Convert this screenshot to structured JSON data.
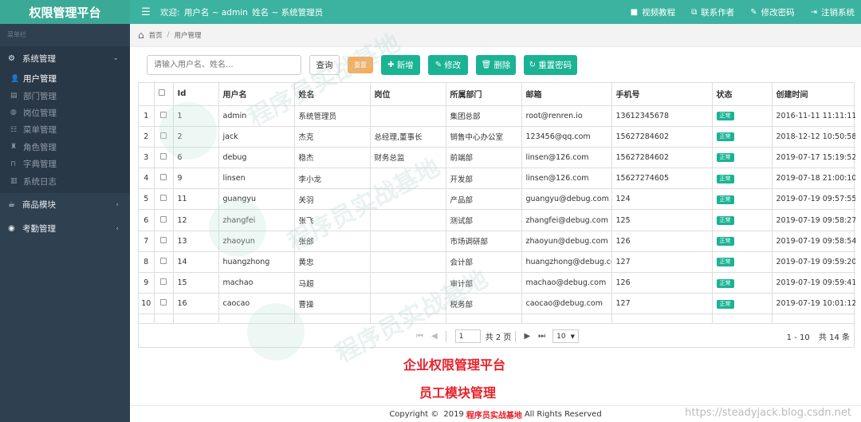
{
  "header": {
    "brand": "权限管理平台",
    "welcome_prefix": "欢迎:",
    "welcome_user": "用户名 ~ admin",
    "welcome_name": "姓名 ~ 系统管理员",
    "links": [
      {
        "label": "视频教程",
        "icon": "video-icon"
      },
      {
        "label": "联系作者",
        "icon": "external-link-icon"
      },
      {
        "label": "修改密码",
        "icon": "edit-icon"
      },
      {
        "label": "注销系统",
        "icon": "logout-icon"
      }
    ]
  },
  "sidebar": {
    "title": "菜单栏",
    "group_system": "系统管理",
    "items": [
      {
        "label": "用户管理",
        "icon": "user-icon"
      },
      {
        "label": "部门管理",
        "icon": "document-icon"
      },
      {
        "label": "岗位管理",
        "icon": "globe-icon"
      },
      {
        "label": "菜单管理",
        "icon": "list-icon"
      },
      {
        "label": "角色管理",
        "icon": "tower-icon"
      },
      {
        "label": "字典管理",
        "icon": "bookmark-icon"
      },
      {
        "label": "系统日志",
        "icon": "log-icon"
      }
    ],
    "group_goods": "商品模块",
    "group_attendance": "考勤管理"
  },
  "breadcrumb": {
    "home": "首页",
    "current": "用户管理"
  },
  "toolbar": {
    "search_placeholder": "请输入用户名、姓名...",
    "query": "查询",
    "reset": "重置",
    "add": "新增",
    "edit": "修改",
    "delete": "删除",
    "reset_pwd": "重置密码"
  },
  "table": {
    "headers": [
      "Id",
      "用户名",
      "姓名",
      "岗位",
      "所属部门",
      "邮箱",
      "手机号",
      "状态",
      "创建时间"
    ],
    "rows": [
      {
        "n": "1",
        "id": "1",
        "username": "admin",
        "name": "系统管理员",
        "post": "",
        "dept": "集团总部",
        "email": "root@renren.io",
        "phone": "13612345678",
        "status": "正常",
        "created": "2016-11-11 11:11:11"
      },
      {
        "n": "2",
        "id": "2",
        "username": "jack",
        "name": "杰克",
        "post": "总经理,董事长",
        "dept": "销售中心办公室",
        "email": "123456@qq.com",
        "phone": "15627284602",
        "status": "正常",
        "created": "2018-12-12 10:50:58"
      },
      {
        "n": "3",
        "id": "6",
        "username": "debug",
        "name": "稳杰",
        "post": "财务总监",
        "dept": "前端部",
        "email": "linsen@126.com",
        "phone": "15627284602",
        "status": "正常",
        "created": "2019-07-17 15:19:52"
      },
      {
        "n": "4",
        "id": "9",
        "username": "linsen",
        "name": "李小龙",
        "post": "",
        "dept": "开发部",
        "email": "linsen@126.com",
        "phone": "15627274605",
        "status": "正常",
        "created": "2019-07-18 21:00:10"
      },
      {
        "n": "5",
        "id": "11",
        "username": "guangyu",
        "name": "关羽",
        "post": "",
        "dept": "产品部",
        "email": "guangyu@debug.com",
        "phone": "124",
        "status": "正常",
        "created": "2019-07-19 09:57:55"
      },
      {
        "n": "6",
        "id": "12",
        "username": "zhangfei",
        "name": "张飞",
        "post": "",
        "dept": "测试部",
        "email": "zhangfei@debug.com",
        "phone": "125",
        "status": "正常",
        "created": "2019-07-19 09:58:27"
      },
      {
        "n": "7",
        "id": "13",
        "username": "zhaoyun",
        "name": "张郃",
        "post": "",
        "dept": "市场调研部",
        "email": "zhaoyun@debug.com",
        "phone": "126",
        "status": "正常",
        "created": "2019-07-19 09:58:54"
      },
      {
        "n": "8",
        "id": "14",
        "username": "huangzhong",
        "name": "黄忠",
        "post": "",
        "dept": "会计部",
        "email": "huangzhong@debug.com",
        "phone": "127",
        "status": "正常",
        "created": "2019-07-19 09:59:20"
      },
      {
        "n": "9",
        "id": "15",
        "username": "machao",
        "name": "马超",
        "post": "",
        "dept": "审计部",
        "email": "machao@debug.com",
        "phone": "126",
        "status": "正常",
        "created": "2019-07-19 09:59:41"
      },
      {
        "n": "10",
        "id": "16",
        "username": "caocao",
        "name": "曹操",
        "post": "",
        "dept": "税务部",
        "email": "caocao@debug.com",
        "phone": "127",
        "status": "正常",
        "created": "2019-07-19 10:01:12"
      }
    ]
  },
  "pager": {
    "page": "1",
    "total_pages": "共 2 页",
    "page_size": "10",
    "range": "1 - 10",
    "total": "共 14 条"
  },
  "overlay": {
    "line1": "企业权限管理平台",
    "line2": "员工模块管理"
  },
  "footer": {
    "copyright": "Copyright ©",
    "year": "2019",
    "brand": "程序员实战基地",
    "rights": "All Rights Reserved",
    "url": "https://steadyjack.blog.csdn.net"
  },
  "watermark": "程序员实战基地",
  "colors": {
    "brand_teal": "#3bb3a0",
    "sidebar_bg": "#2f4050",
    "primary_button": "#1ab394",
    "warning_button": "#f8ac59",
    "overlay_red": "#e8202a"
  }
}
